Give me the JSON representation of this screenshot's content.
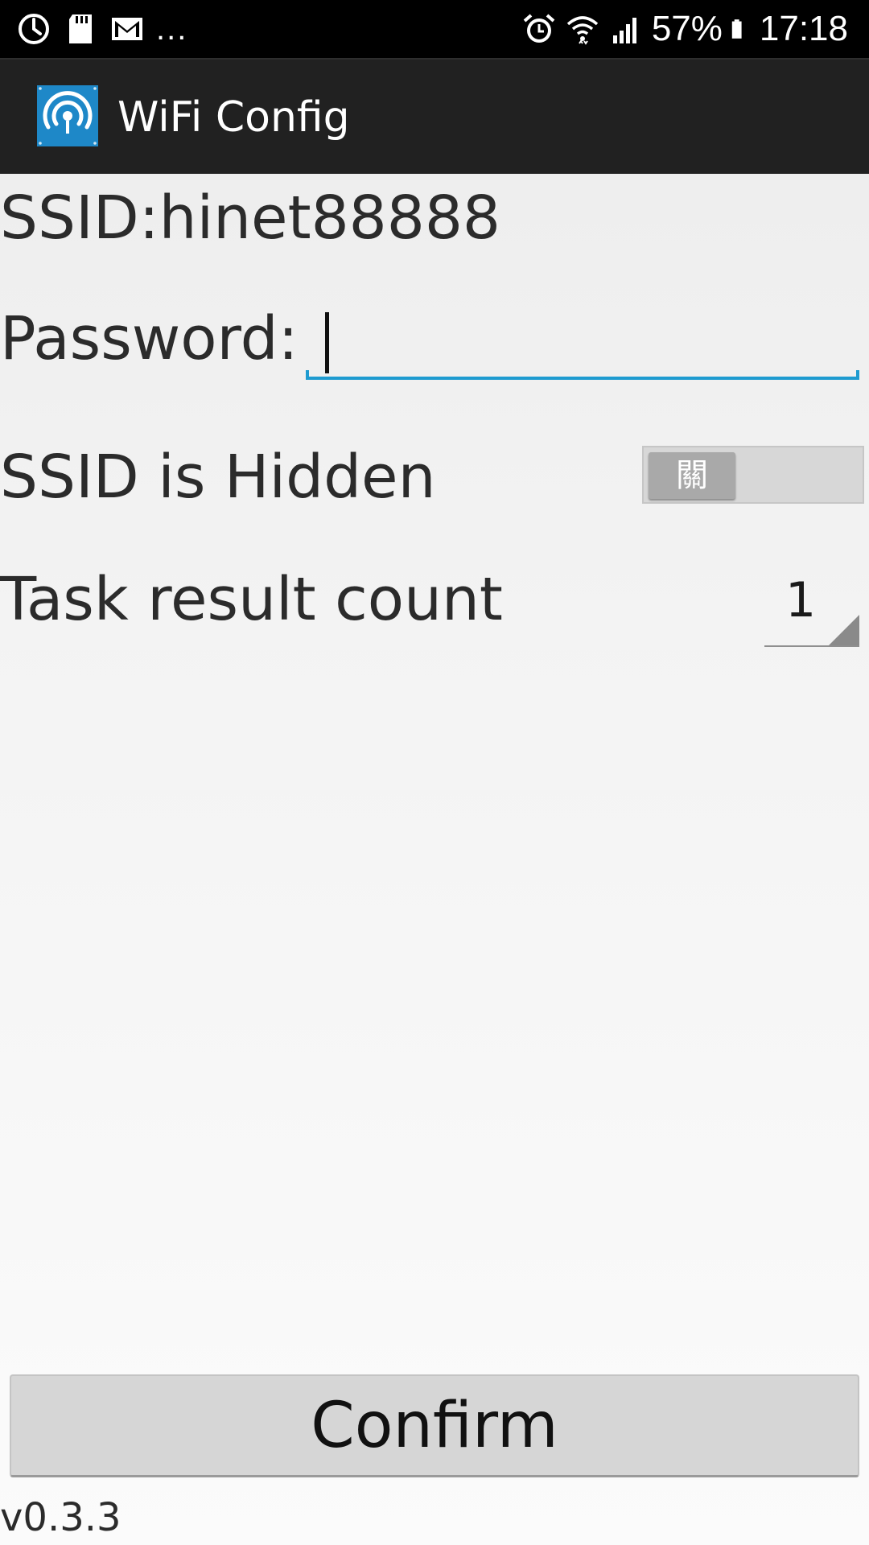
{
  "status_bar": {
    "icons": [
      "sync-icon",
      "sd-card-icon",
      "gmail-icon"
    ],
    "overflow": "...",
    "right_icons": [
      "alarm-icon",
      "wifi-icon",
      "signal-icon",
      "battery-icon"
    ],
    "battery": "57%",
    "time": "17:18"
  },
  "app_bar": {
    "icon": "wifi-config-app-icon",
    "title": "WiFi Config",
    "accent_color": "#1e88c8"
  },
  "form": {
    "ssid_label": "SSID:hinet88888",
    "password_label": "Password:",
    "password_value": "",
    "password_underline_color": "#1e9bd0",
    "hidden_label": "SSID is Hidden",
    "hidden_toggle_state": "關",
    "hidden_toggle_on": false,
    "count_label": "Task result count",
    "count_value": "1"
  },
  "confirm_button": {
    "label": "Confirm"
  },
  "version": "v0.3.3"
}
